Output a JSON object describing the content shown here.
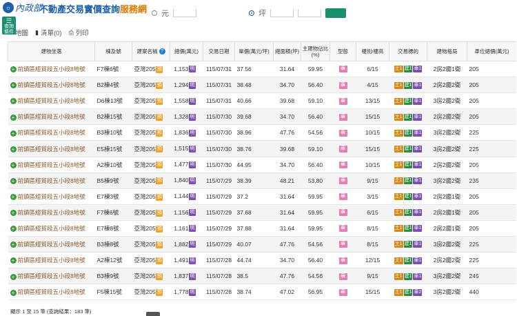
{
  "header": {
    "ministry_logo_text": "內政部",
    "site_title_main": "不動產交易實價查詢",
    "site_title_highlight": "服務網"
  },
  "filters": {
    "radio_a_label": "元",
    "radio_b_label": "坪"
  },
  "condition_tab": {
    "icon": "filter-icon",
    "label_line1": "查詢",
    "label_line2": "條件"
  },
  "viewbar": {
    "map_label": "地圖",
    "list_label": "清單(0)",
    "print_label": "列印"
  },
  "table": {
    "headers": {
      "address": "建物坐落",
      "unit": "棟及號",
      "project": "建案名稱",
      "total_price": "總價(萬元)",
      "date": "交易日期",
      "unit_price": "單價(萬元/坪)",
      "total_area": "總面積(坪)",
      "main_ratio": "主建物佔比(%)",
      "type": "型態",
      "floor": "樓別/樓高",
      "target": "交易標的",
      "layout": "建物格局",
      "parking_price": "車位總價(萬元)"
    },
    "rows": [
      {
        "address": "前鎮區經貿段五小段8地號",
        "unit": "F7棟6號",
        "project": "亞灣205",
        "total_price": "1,153",
        "date": "115/07/31",
        "unit_price": "37.56",
        "total_area": "31.64",
        "main_ratio": "59.95",
        "floor": "6/15",
        "target": [
          "土1",
          "建1",
          "車1"
        ],
        "layout": "2房2廳1衛",
        "parking_price": "205"
      },
      {
        "address": "前鎮區經貿段五小段8地號",
        "unit": "B2棟4號",
        "project": "亞灣205",
        "total_price": "1,294",
        "date": "115/07/31",
        "unit_price": "38.48",
        "total_area": "34.70",
        "main_ratio": "56.40",
        "floor": "4/15",
        "target": [
          "土1",
          "建1",
          "車1"
        ],
        "layout": "2房2廳2衛",
        "parking_price": "205"
      },
      {
        "address": "前鎮區經貿段五小段8地號",
        "unit": "D6棟13號",
        "project": "亞灣205",
        "total_price": "1,558",
        "date": "115/07/31",
        "unit_price": "40.66",
        "total_area": "39.68",
        "main_ratio": "59.10",
        "floor": "13/15",
        "target": [
          "土1",
          "建1",
          "車1"
        ],
        "layout": "3房2廳2衛",
        "parking_price": "205"
      },
      {
        "address": "前鎮區經貿段五小段8地號",
        "unit": "B2棟15號",
        "project": "亞灣205",
        "total_price": "1,328",
        "date": "115/07/30",
        "unit_price": "39.68",
        "total_area": "34.70",
        "main_ratio": "56.40",
        "floor": "15/15",
        "target": [
          "土1",
          "建1",
          "車1"
        ],
        "layout": "2房2廳2衛",
        "parking_price": "205"
      },
      {
        "address": "前鎮區經貿段五小段8地號",
        "unit": "B3棟10號",
        "project": "亞灣205",
        "total_price": "1,836",
        "date": "115/07/30",
        "unit_price": "38.96",
        "total_area": "47.76",
        "main_ratio": "54.56",
        "floor": "10/15",
        "target": [
          "土1",
          "建1",
          "車1"
        ],
        "layout": "3房2廳2衛",
        "parking_price": "225"
      },
      {
        "address": "前鎮區經貿段五小段8地號",
        "unit": "E5棟15號",
        "project": "亞灣205",
        "total_price": "1,515",
        "date": "115/07/30",
        "unit_price": "38.76",
        "total_area": "39.68",
        "main_ratio": "59.10",
        "floor": "15/15",
        "target": [
          "土1",
          "建1",
          "車1"
        ],
        "layout": "3房2廳2衛",
        "parking_price": "225"
      },
      {
        "address": "前鎮區經貿段五小段8地號",
        "unit": "A2棟10號",
        "project": "亞灣205",
        "total_price": "1,477",
        "date": "115/07/30",
        "unit_price": "44.95",
        "total_area": "34.70",
        "main_ratio": "56.40",
        "floor": "10/15",
        "target": [
          "土1",
          "建1",
          "車1"
        ],
        "layout": "2房2廳2衛",
        "parking_price": "205"
      },
      {
        "address": "前鎮區經貿段五小段8地號",
        "unit": "B5棟9號",
        "project": "亞灣205",
        "total_price": "1,840",
        "date": "115/07/29",
        "unit_price": "38.39",
        "total_area": "48.21",
        "main_ratio": "53.80",
        "floor": "9/15",
        "target": [
          "土1",
          "建1",
          "車1"
        ],
        "layout": "3房2廳2衛",
        "parking_price": "235"
      },
      {
        "address": "前鎮區經貿段五小段8地號",
        "unit": "E7棟3號",
        "project": "亞灣205",
        "total_price": "1,144",
        "date": "115/07/29",
        "unit_price": "37.2",
        "total_area": "31.64",
        "main_ratio": "59.95",
        "floor": "3/15",
        "target": [
          "土1",
          "建1",
          "車1"
        ],
        "layout": "2房2廳1衛",
        "parking_price": "205"
      },
      {
        "address": "前鎮區經貿段五小段8地號",
        "unit": "F7棟6號",
        "project": "亞灣205",
        "total_price": "1,156",
        "date": "115/07/29",
        "unit_price": "37.68",
        "total_area": "31.64",
        "main_ratio": "59.95",
        "floor": "6/15",
        "target": [
          "土1",
          "建1",
          "車1"
        ],
        "layout": "2房2廳1衛",
        "parking_price": "205"
      },
      {
        "address": "前鎮區經貿段五小段8地號",
        "unit": "E7棟8號",
        "project": "亞灣205",
        "total_price": "1,161",
        "date": "115/07/29",
        "unit_price": "37.88",
        "total_area": "31.64",
        "main_ratio": "59.95",
        "floor": "8/15",
        "target": [
          "土1",
          "建1",
          "車1"
        ],
        "layout": "2房2廳1衛",
        "parking_price": "205"
      },
      {
        "address": "前鎮區經貿段五小段8地號",
        "unit": "B3棟8號",
        "project": "亞灣205",
        "total_price": "1,882",
        "date": "115/07/29",
        "unit_price": "40.07",
        "total_area": "47.76",
        "main_ratio": "54.56",
        "floor": "8/15",
        "target": [
          "土1",
          "建1",
          "車1"
        ],
        "layout": "3房2廳2衛",
        "parking_price": "225"
      },
      {
        "address": "前鎮區經貿段五小段8地號",
        "unit": "A2棟12號",
        "project": "亞灣205",
        "total_price": "1,491",
        "date": "115/07/28",
        "unit_price": "44.74",
        "total_area": "34.70",
        "main_ratio": "56.40",
        "floor": "12/15",
        "target": [
          "土1",
          "建1",
          "車1"
        ],
        "layout": "2房2廳2衛",
        "parking_price": "225"
      },
      {
        "address": "前鎮區經貿段五小段8地號",
        "unit": "B3棟9號",
        "project": "亞灣205",
        "total_price": "1,837",
        "date": "115/07/28",
        "unit_price": "38.5",
        "total_area": "47.76",
        "main_ratio": "54.56",
        "floor": "9/15",
        "target": [
          "土1",
          "建1",
          "車1"
        ],
        "layout": "3房2廳2衛",
        "parking_price": "245"
      },
      {
        "address": "前鎮區經貿段五小段8地號",
        "unit": "F5棟15號",
        "project": "亞灣205",
        "total_price": "1,778",
        "date": "115/07/28",
        "unit_price": "38.74",
        "total_area": "47.02",
        "main_ratio": "56.95",
        "floor": "15/15",
        "target": [
          "土1",
          "建1",
          "車2"
        ],
        "layout": "3房2廳2衛",
        "parking_price": "440"
      }
    ],
    "presale_badge": "預",
    "sheet_badge": "明",
    "type_badge": "華"
  },
  "footer": {
    "summary": "顯示 1 至 15 筆 (查詢結果：183 筆)"
  },
  "colors": {
    "brand_blue": "#1f5fa8",
    "accent_green": "#1a8f6d",
    "address_brown": "#8a5a2b"
  }
}
